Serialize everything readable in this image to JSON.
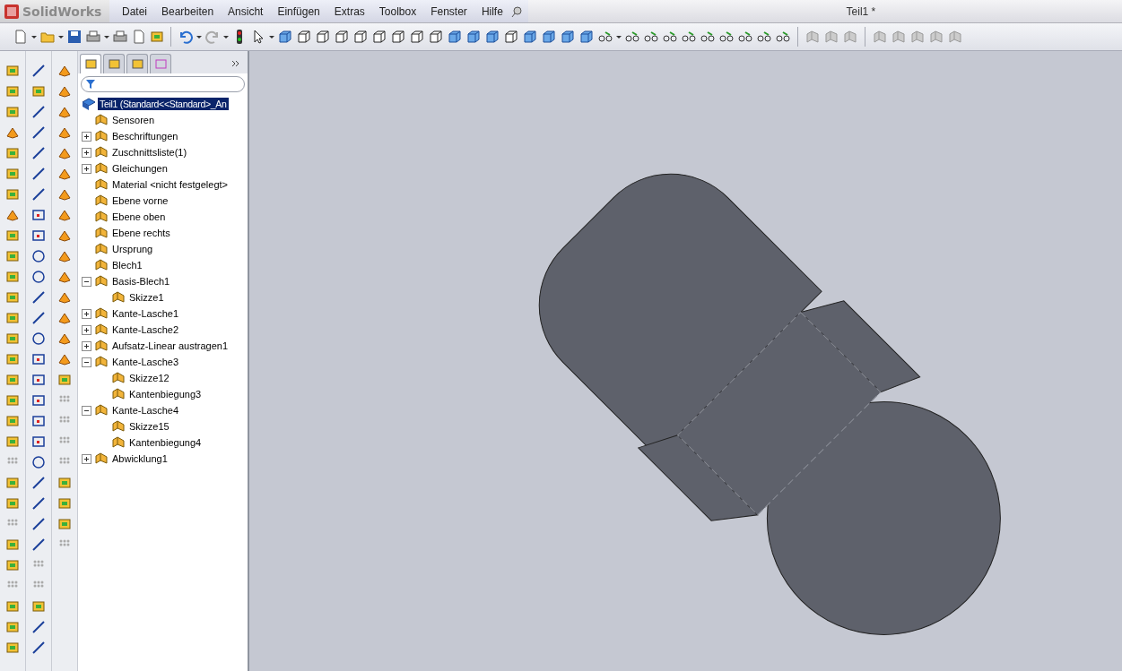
{
  "app_name": "SolidWorks",
  "menu": [
    "Datei",
    "Bearbeiten",
    "Ansicht",
    "Einfügen",
    "Extras",
    "Toolbox",
    "Fenster",
    "Hilfe"
  ],
  "document_title": "Teil1 *",
  "panel_tabs": [
    {
      "selected": true
    },
    {
      "selected": false
    },
    {
      "selected": false
    },
    {
      "selected": false
    }
  ],
  "feature_tree": {
    "root": {
      "label": "Teil1  (Standard<<Standard>_An",
      "selected": true
    },
    "items": [
      {
        "label": "Sensoren",
        "selected": false
      },
      {
        "label": "Beschriftungen",
        "selected": false,
        "expanded": false
      },
      {
        "label": "Zuschnittsliste(1)",
        "selected": false,
        "expanded": false
      },
      {
        "label": "Gleichungen",
        "selected": false,
        "expanded": false
      },
      {
        "label": "Material <nicht festgelegt>",
        "selected": false
      },
      {
        "label": "Ebene vorne",
        "selected": false
      },
      {
        "label": "Ebene oben",
        "selected": false
      },
      {
        "label": "Ebene rechts",
        "selected": false
      },
      {
        "label": "Ursprung",
        "selected": false
      },
      {
        "label": "Blech1",
        "selected": false
      },
      {
        "label": "Basis-Blech1",
        "selected": false,
        "expanded": true,
        "children": [
          {
            "label": "Skizze1",
            "selected": false
          }
        ]
      },
      {
        "label": "Kante-Lasche1",
        "selected": false,
        "expanded": false
      },
      {
        "label": "Kante-Lasche2",
        "selected": false,
        "expanded": false
      },
      {
        "label": "Aufsatz-Linear austragen1",
        "selected": false,
        "expanded": false
      },
      {
        "label": "Kante-Lasche3",
        "selected": false,
        "expanded": true,
        "children": [
          {
            "label": "Skizze12",
            "selected": false
          },
          {
            "label": "Kantenbiegung3",
            "selected": false
          }
        ]
      },
      {
        "label": "Kante-Lasche4",
        "selected": false,
        "expanded": true,
        "children": [
          {
            "label": "Skizze15",
            "selected": false
          },
          {
            "label": "Kantenbiegung4",
            "selected": false
          }
        ]
      },
      {
        "label": "Abwicklung1",
        "selected": false,
        "expanded": false
      }
    ]
  }
}
